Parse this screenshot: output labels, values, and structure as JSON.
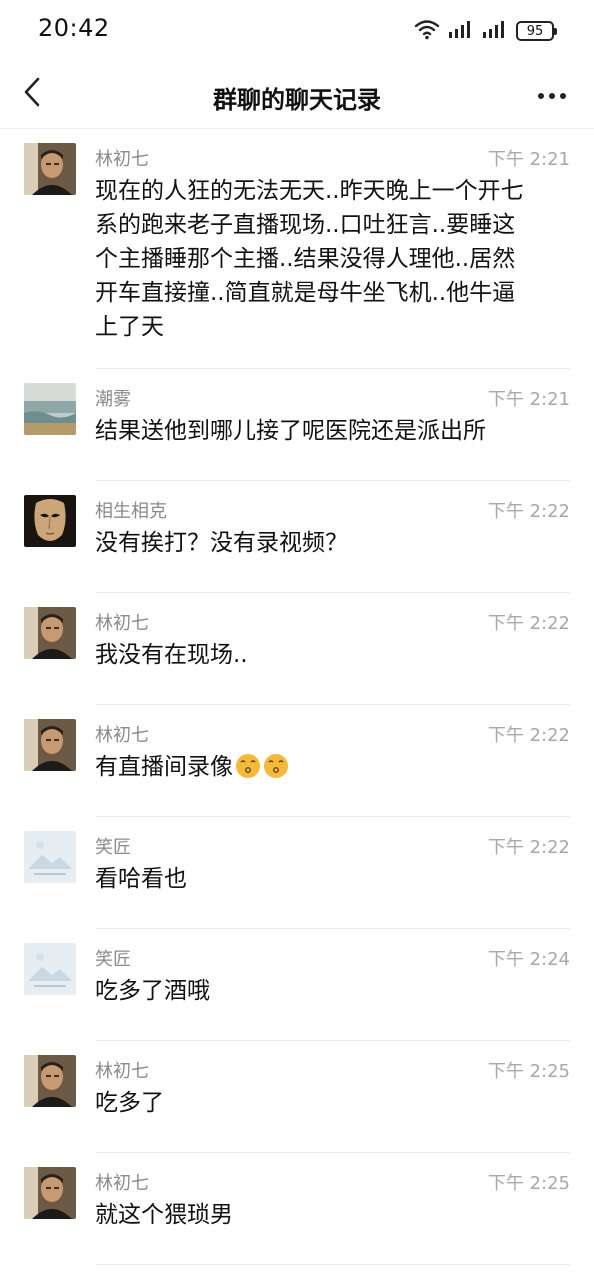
{
  "status_bar": {
    "time": "20:42",
    "battery": "95"
  },
  "header": {
    "title": "群聊的聊天记录"
  },
  "messages": [
    {
      "name": "林初七",
      "time": "下午 2:21",
      "text": "现在的人狂的无法无天..昨天晚上一个开七\n系的跑来老子直播现场..口吐狂言..要睡这\n个主播睡那个主播..结果没得人理他..居然\n开车直接撞..简直就是母牛坐飞机..他牛逼\n上了天",
      "avatar": "person-avatar"
    },
    {
      "name": "潮雾",
      "time": "下午 2:21",
      "text": "结果送他到哪儿接了呢医院还是派出所",
      "avatar": "landscape-avatar"
    },
    {
      "name": "相生相克",
      "time": "下午 2:22",
      "text": "没有挨打？没有录视频？",
      "avatar": "mask-avatar"
    },
    {
      "name": "林初七",
      "time": "下午 2:22",
      "text": "我没有在现场..",
      "avatar": "person-avatar"
    },
    {
      "name": "林初七",
      "time": "下午 2:22",
      "text": "有直播间录像",
      "avatar": "person-avatar",
      "emojis": [
        "kissing-face-emoji",
        "kissing-face-emoji"
      ]
    },
    {
      "name": "笑匠",
      "time": "下午 2:22",
      "text": "看哈看也",
      "avatar": "placeholder-avatar"
    },
    {
      "name": "笑匠",
      "time": "下午 2:24",
      "text": "吃多了酒哦",
      "avatar": "placeholder-avatar"
    },
    {
      "name": "林初七",
      "time": "下午 2:25",
      "text": "吃多了",
      "avatar": "person-avatar"
    },
    {
      "name": "林初七",
      "time": "下午 2:25",
      "text": "就这个猥琐男",
      "avatar": "person-avatar"
    }
  ]
}
